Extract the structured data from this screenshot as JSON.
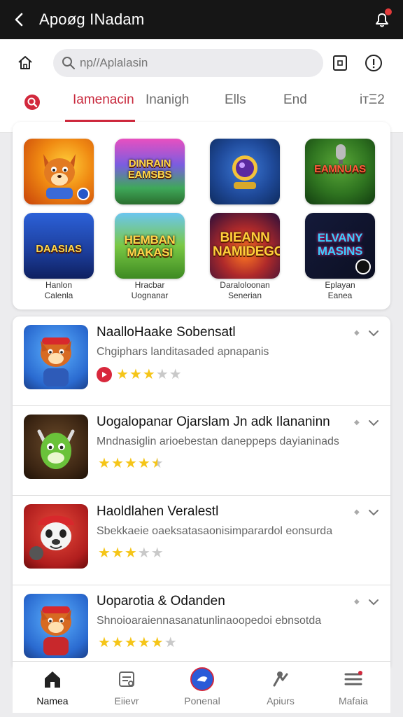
{
  "app": {
    "title": "Apoøg INadam"
  },
  "search": {
    "placeholder": "np//Aplalasin"
  },
  "tabs": [
    {
      "label": "Iamenacin",
      "active": true
    },
    {
      "label": "Inanigh",
      "active": false
    },
    {
      "label": "Ells",
      "active": false
    },
    {
      "label": "End",
      "active": false
    },
    {
      "label": "ітΞ2",
      "active": false
    }
  ],
  "featured": [
    {
      "caption": "",
      "label_line1": "",
      "label_line2": ""
    },
    {
      "caption": "DINRAIN EAMSBS",
      "label_line1": "",
      "label_line2": ""
    },
    {
      "caption": "",
      "label_line1": "",
      "label_line2": ""
    },
    {
      "caption": "EAMNUAS",
      "label_line1": "",
      "label_line2": ""
    },
    {
      "caption": "DAASIAS",
      "label_line1": "Hanlon",
      "label_line2": "Calenla"
    },
    {
      "caption": "HEMBAN MAKASI",
      "label_line1": "Hracbar",
      "label_line2": "Uognanar"
    },
    {
      "caption": "BIEANN NAMIDEGO",
      "label_line1": "Daraloloonan",
      "label_line2": "Senerian"
    },
    {
      "caption": "ELVANY MASINS",
      "label_line1": "Eplayan",
      "label_line2": "Eanea"
    }
  ],
  "list": [
    {
      "name": "NaalloHaake Sobensatl",
      "subtitle": "Chgiphars landitasaded apnapanis",
      "rating": 3,
      "has_badge": true
    },
    {
      "name": "Uogalopanar Ojarslam Jn adk Ilananinn",
      "subtitle": "Mndnasiglin arioebestan daneppeps dayianinads",
      "rating": 4.5,
      "has_badge": false
    },
    {
      "name": "Haoldlahen Veralestl",
      "subtitle": "Sbekkaeie oaeksatasaonisimparardol eonsurda",
      "rating": 3,
      "has_badge": false
    },
    {
      "name": "Uoparotia & Odanden",
      "subtitle": "Shnoioaraiennasanatunlinaoopedoi ebnsotda",
      "rating": 5,
      "has_badge": false
    }
  ],
  "bottom_nav": [
    {
      "label": "Namea",
      "icon": "home-icon",
      "active": true
    },
    {
      "label": "Eiievr",
      "icon": "document-icon",
      "active": false
    },
    {
      "label": "Ponenal",
      "icon": "chat-icon",
      "active": false
    },
    {
      "label": "Apiurs",
      "icon": "apps-icon",
      "active": false
    },
    {
      "label": "Mafaia",
      "icon": "menu-icon",
      "active": false
    }
  ],
  "colors": {
    "accent": "#d2283c",
    "star": "#f5c518",
    "titlebar": "#161616"
  }
}
